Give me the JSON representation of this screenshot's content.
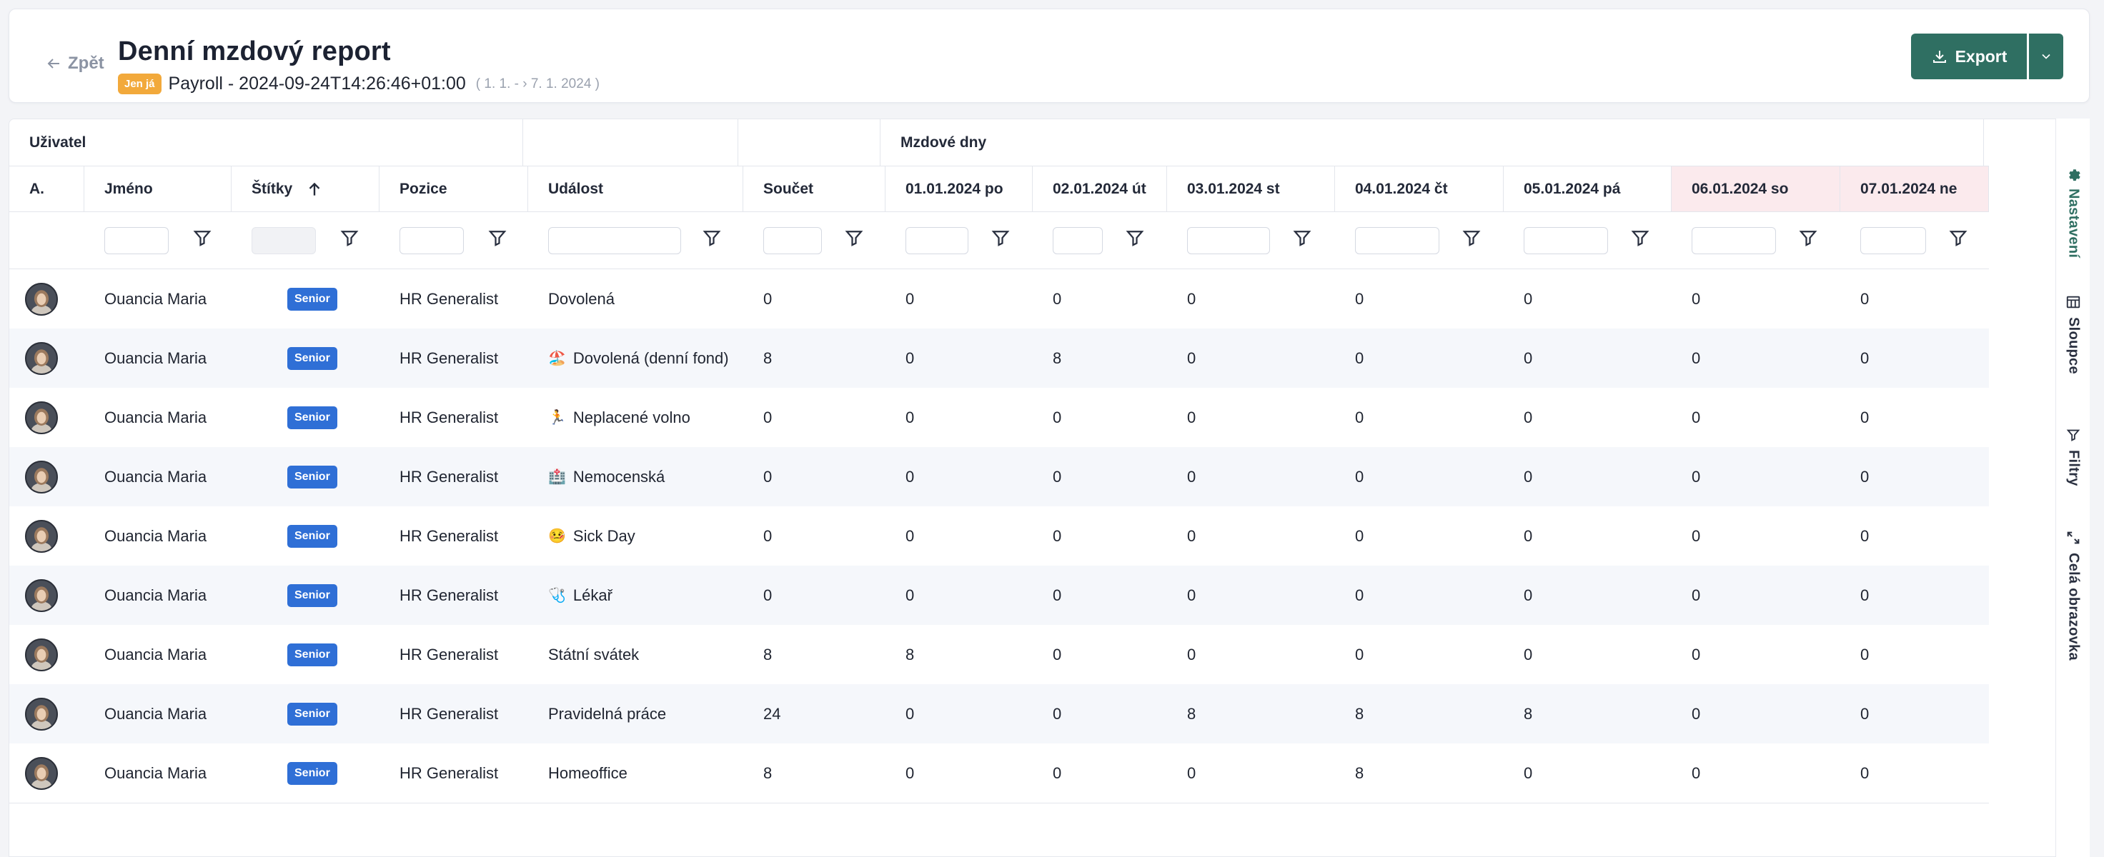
{
  "header": {
    "back_label": "Zpět",
    "title": "Denní mzdový report",
    "only_me_badge": "Jen já",
    "period": "Payroll - 2024-09-24T14:26:46+01:00",
    "range": "( 1. 1. - › 7. 1. 2024 )",
    "export_label": "Export"
  },
  "table": {
    "groups": {
      "user": "Uživatel",
      "payroll_days": "Mzdové dny"
    },
    "columns": {
      "avatar": "A.",
      "name": "Jméno",
      "tags": "Štítky",
      "position": "Pozice",
      "event": "Událost",
      "sum": "Součet",
      "days": [
        "01.01.2024 po",
        "02.01.2024 út",
        "03.01.2024 st",
        "04.01.2024 čt",
        "05.01.2024 pá",
        "06.01.2024 so",
        "07.01.2024 ne"
      ]
    },
    "sort": {
      "column": "Štítky",
      "direction": "ascending"
    },
    "rows": [
      {
        "name": "Ouancia Maria",
        "tag": "Senior",
        "position": "HR Generalist",
        "event_icon": "",
        "event": "Dovolená",
        "sum": "0",
        "days": [
          "0",
          "0",
          "0",
          "0",
          "0",
          "0",
          "0"
        ]
      },
      {
        "name": "Ouancia Maria",
        "tag": "Senior",
        "position": "HR Generalist",
        "event_icon": "🏖️",
        "event": "Dovolená (denní fond)",
        "sum": "8",
        "days": [
          "0",
          "8",
          "0",
          "0",
          "0",
          "0",
          "0"
        ]
      },
      {
        "name": "Ouancia Maria",
        "tag": "Senior",
        "position": "HR Generalist",
        "event_icon": "🏃",
        "event": "Neplacené volno",
        "sum": "0",
        "days": [
          "0",
          "0",
          "0",
          "0",
          "0",
          "0",
          "0"
        ]
      },
      {
        "name": "Ouancia Maria",
        "tag": "Senior",
        "position": "HR Generalist",
        "event_icon": "🏥",
        "event": "Nemocenská",
        "sum": "0",
        "days": [
          "0",
          "0",
          "0",
          "0",
          "0",
          "0",
          "0"
        ]
      },
      {
        "name": "Ouancia Maria",
        "tag": "Senior",
        "position": "HR Generalist",
        "event_icon": "🤒",
        "event": "Sick Day",
        "sum": "0",
        "days": [
          "0",
          "0",
          "0",
          "0",
          "0",
          "0",
          "0"
        ]
      },
      {
        "name": "Ouancia Maria",
        "tag": "Senior",
        "position": "HR Generalist",
        "event_icon": "🩺",
        "event": "Lékař",
        "sum": "0",
        "days": [
          "0",
          "0",
          "0",
          "0",
          "0",
          "0",
          "0"
        ]
      },
      {
        "name": "Ouancia Maria",
        "tag": "Senior",
        "position": "HR Generalist",
        "event_icon": "",
        "event": "Státní svátek",
        "sum": "8",
        "days": [
          "8",
          "0",
          "0",
          "0",
          "0",
          "0",
          "0"
        ]
      },
      {
        "name": "Ouancia Maria",
        "tag": "Senior",
        "position": "HR Generalist",
        "event_icon": "",
        "event": "Pravidelná práce",
        "sum": "24",
        "days": [
          "0",
          "0",
          "8",
          "8",
          "8",
          "0",
          "0"
        ]
      },
      {
        "name": "Ouancia Maria",
        "tag": "Senior",
        "position": "HR Generalist",
        "event_icon": "",
        "event": "Homeoffice",
        "sum": "8",
        "days": [
          "0",
          "0",
          "0",
          "8",
          "0",
          "0",
          "0"
        ]
      }
    ]
  },
  "sidebar": {
    "items": [
      {
        "label": "Nastavení",
        "icon": "gear-icon",
        "active": true
      },
      {
        "label": "Sloupce",
        "icon": "columns-icon",
        "active": false
      },
      {
        "label": "Filtry",
        "icon": "filter-icon",
        "active": false
      },
      {
        "label": "Celá obrazovka",
        "icon": "fullscreen-icon",
        "active": false
      }
    ]
  },
  "colors": {
    "primary": "#2f6f62",
    "tag_blue": "#2f6fd6",
    "badge_orange": "#f2a93b",
    "weekend_header": "#fbeaed",
    "row_alt": "#f5f7fb"
  }
}
